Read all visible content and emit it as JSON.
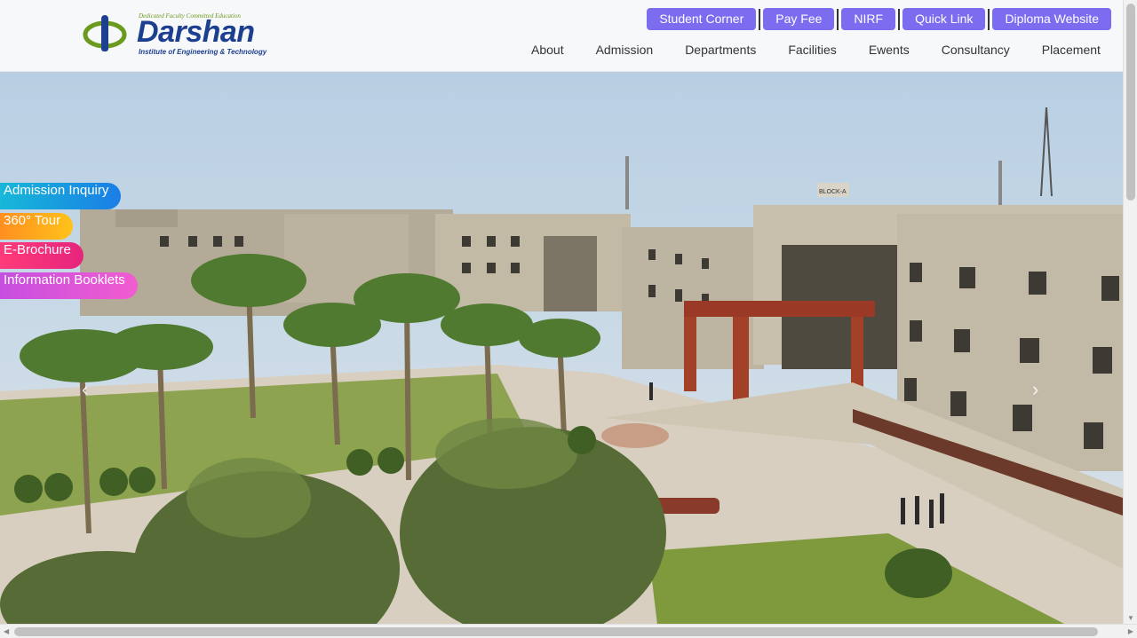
{
  "logo": {
    "tagline": "Dedicated Faculty Committed Education",
    "brand": "Darshan",
    "subtitle": "Institute of Engineering & Technology"
  },
  "top_buttons": [
    "Student Corner",
    "Pay Fee",
    "NIRF",
    "Quick Link",
    "Diploma Website"
  ],
  "nav": [
    "About",
    "Admission",
    "Departments",
    "Facilities",
    "Ewents",
    "Consultancy",
    "Placement"
  ],
  "side_links": [
    "Admission Inquiry",
    "360° Tour",
    "E-Brochure",
    "Information Booklets"
  ],
  "hero": {
    "sign": "BLOCK-A"
  },
  "colors": {
    "button": "#7b6cf0",
    "brand": "#1c3f8f",
    "logo_green": "#6a9a1e"
  }
}
